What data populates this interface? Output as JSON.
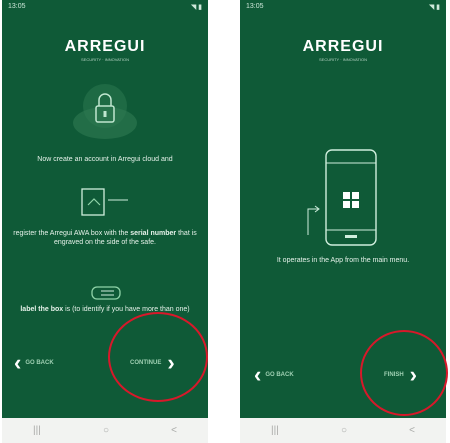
{
  "colors": {
    "screen_bg": "#0f5a37",
    "accent": "#8fd3a8",
    "highlight_circle": "#d8182a"
  },
  "left_phone": {
    "status": {
      "time": "13:05",
      "icons": "◥ ▮"
    },
    "brand": {
      "logo": "ARREGUI",
      "sub": "SECURITY · INNOVATION"
    },
    "text1": "Now create an account in Arregui cloud and",
    "text2_pre": "register the Arregui AWA box with the ",
    "text2_bold": "serial number",
    "text2_post": " that is engraved on the side of the safe.",
    "text3_bold": "label the box",
    "text3_rest": " is (to identify if you have more than one)",
    "back_label": "GO BACK",
    "next_label": "CONTINUE",
    "sys": {
      "recent": "|||",
      "home": "○",
      "back": "<"
    }
  },
  "right_phone": {
    "status": {
      "time": "13:05",
      "icons": "◥ ▮"
    },
    "brand": {
      "logo": "ARREGUI",
      "sub": "SECURITY · INNOVATION"
    },
    "text1": "It operates in the App from the main menu.",
    "back_label": "GO BACK",
    "next_label": "FINISH",
    "sys": {
      "recent": "|||",
      "home": "○",
      "back": "<"
    }
  }
}
